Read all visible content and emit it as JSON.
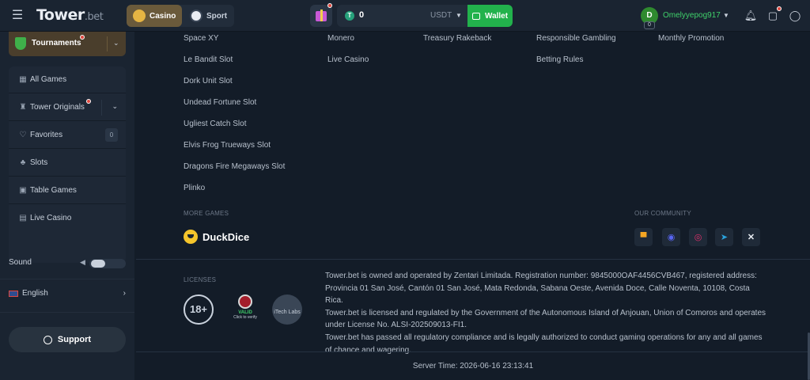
{
  "header": {
    "logo_text": "Tower",
    "logo_suffix": ".bet",
    "tabs": [
      {
        "label": "Casino",
        "active": true
      },
      {
        "label": "Sport",
        "active": false
      }
    ],
    "balance": {
      "amount": "0",
      "currency": "USDT"
    },
    "wallet_label": "Wallet",
    "user": {
      "initial": "D",
      "level": "0",
      "name": "Omelyyepog917"
    }
  },
  "sidebar": {
    "tournaments_label": "Tournaments",
    "items": [
      {
        "label": "All Games",
        "icon": "grid-icon"
      },
      {
        "label": "Tower Originals",
        "icon": "tower-icon"
      },
      {
        "label": "Favorites",
        "icon": "heart-icon",
        "count": "0"
      },
      {
        "label": "Slots",
        "icon": "cherry-icon"
      },
      {
        "label": "Table Games",
        "icon": "cards-icon"
      },
      {
        "label": "Live Casino",
        "icon": "live-icon"
      }
    ],
    "sound_label": "Sound",
    "language_label": "English",
    "support_label": "Support"
  },
  "footer": {
    "col1": [
      "Space XY",
      "Le Bandit Slot",
      "Dork Unit Slot",
      "Undead Fortune Slot",
      "Ugliest Catch Slot",
      "Elvis Frog Trueways Slot",
      "Dragons Fire Megaways Slot",
      "Plinko"
    ],
    "col2": [
      "Monero",
      "Live Casino"
    ],
    "col3": [
      "Treasury Rakeback"
    ],
    "col4": [
      "Responsible Gambling",
      "Betting Rules"
    ],
    "col5": [
      "Monthly Promotion"
    ],
    "more_games_label": "MORE GAMES",
    "duckdice_label": "DuckDice",
    "community_label": "OUR COMMUNITY",
    "licenses_label": "LICENSES",
    "badge_18": "18+",
    "seal_valid": "VALID",
    "seal_click": "Click to verify",
    "itech_label": "iTech Labs",
    "legal": [
      "Tower.bet is owned and operated by Zentari Limitada. Registration number: 9845000OAF4456CVB467, registered address: Provincia 01 San José, Cantón 01 San José, Mata Redonda, Sabana Oeste, Avenida Doce, Calle Noventa, 10108, Costa Rica.",
      "Tower.bet is licensed and regulated by the Government of the Autonomous Island of Anjouan, Union of Comoros and operates under License No. ALSI-202509013-FI1.",
      "Tower.bet has passed all regulatory compliance and is legally authorized to conduct gaming operations for any and all games of chance and wagering."
    ],
    "server_time": "Server Time: 2026-06-16 23:13:41"
  }
}
